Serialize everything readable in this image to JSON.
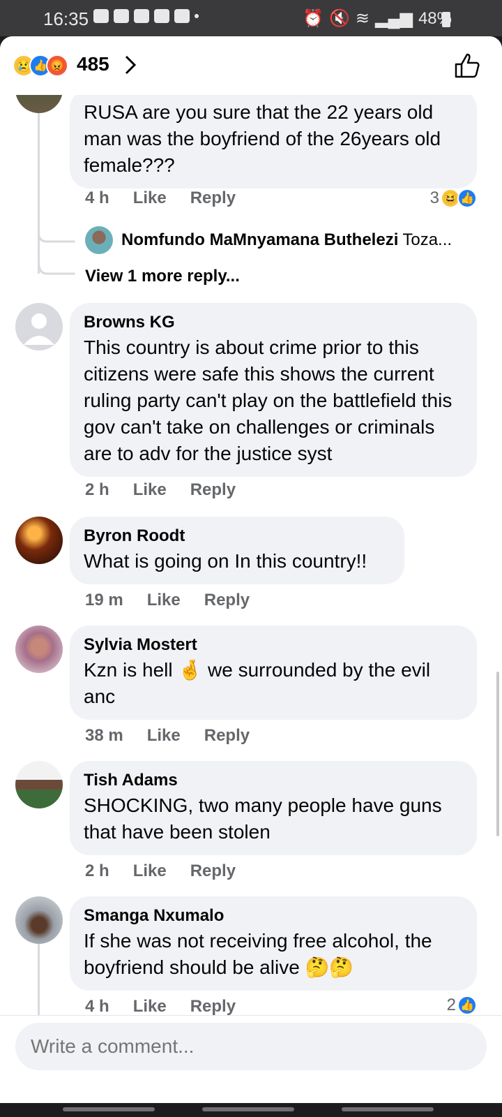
{
  "status_bar": {
    "time": "16:35",
    "battery": "48%"
  },
  "header": {
    "reaction_count": "485"
  },
  "comments": [
    {
      "id": "c0",
      "text": "RUSA are you sure that the 22 years old man was the boyfriend of the 26years old female???",
      "time": "4 h",
      "like": "Like",
      "reply": "Reply",
      "reactions": "3"
    },
    {
      "id": "c1",
      "author": "Browns KG",
      "text": "This country is about crime prior to this citizens were safe this shows the current ruling party can't play on the battlefield this gov can't take on challenges or criminals are to adv for the justice syst",
      "time": "2 h",
      "like": "Like",
      "reply": "Reply"
    },
    {
      "id": "c2",
      "author": "Byron Roodt",
      "text": "What is going on In this country!!",
      "time": "19 m",
      "like": "Like",
      "reply": "Reply"
    },
    {
      "id": "c3",
      "author": "Sylvia Mostert",
      "text": "Kzn is hell 🤞 we surrounded by the evil anc",
      "time": "38 m",
      "like": "Like",
      "reply": "Reply"
    },
    {
      "id": "c4",
      "author": "Tish Adams",
      "text": "SHOCKING, two many people have guns that have been stolen",
      "time": "2 h",
      "like": "Like",
      "reply": "Reply"
    },
    {
      "id": "c5",
      "author": "Smanga Nxumalo",
      "text": "If she was not receiving free alcohol, the boyfriend should be alive 🤔🤔",
      "time": "4 h",
      "like": "Like",
      "reply": "Reply",
      "reactions": "2"
    }
  ],
  "reply_preview": {
    "author": "Nomfundo MaMnyamana Buthelezi",
    "snippet": "Toza..."
  },
  "view_more": "View 1 more reply...",
  "composer": {
    "placeholder": "Write a comment..."
  },
  "colors": {
    "accent": "#1d7cf2",
    "bubble": "#f0f2f5",
    "muted": "#65676b"
  }
}
